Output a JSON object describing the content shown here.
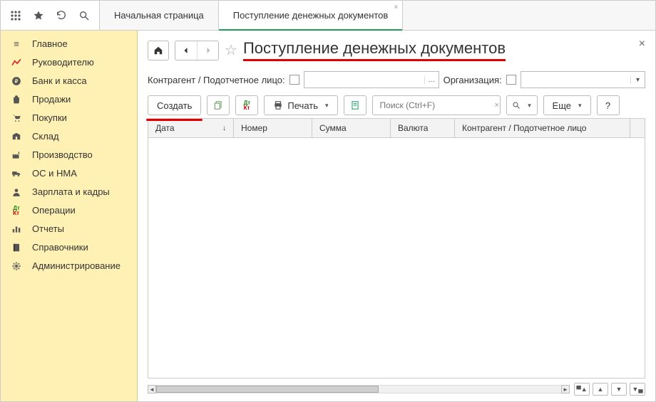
{
  "tabs": {
    "home": "Начальная страница",
    "active": "Поступление денежных документов"
  },
  "sidebar": [
    {
      "label": "Главное"
    },
    {
      "label": "Руководителю"
    },
    {
      "label": "Банк и касса"
    },
    {
      "label": "Продажи"
    },
    {
      "label": "Покупки"
    },
    {
      "label": "Склад"
    },
    {
      "label": "Производство"
    },
    {
      "label": "ОС и НМА"
    },
    {
      "label": "Зарплата и кадры"
    },
    {
      "label": "Операции"
    },
    {
      "label": "Отчеты"
    },
    {
      "label": "Справочники"
    },
    {
      "label": "Администрирование"
    }
  ],
  "page": {
    "title": "Поступление денежных документов",
    "filter": {
      "counterparty_label": "Контрагент / Подотчетное лицо:",
      "org_label": "Организация:"
    },
    "toolbar": {
      "create": "Создать",
      "print": "Печать",
      "search_placeholder": "Поиск (Ctrl+F)",
      "more": "Еще",
      "help": "?"
    },
    "columns": {
      "date": "Дата",
      "number": "Номер",
      "sum": "Сумма",
      "currency": "Валюта",
      "counterparty": "Контрагент / Подотчетное лицо"
    }
  }
}
